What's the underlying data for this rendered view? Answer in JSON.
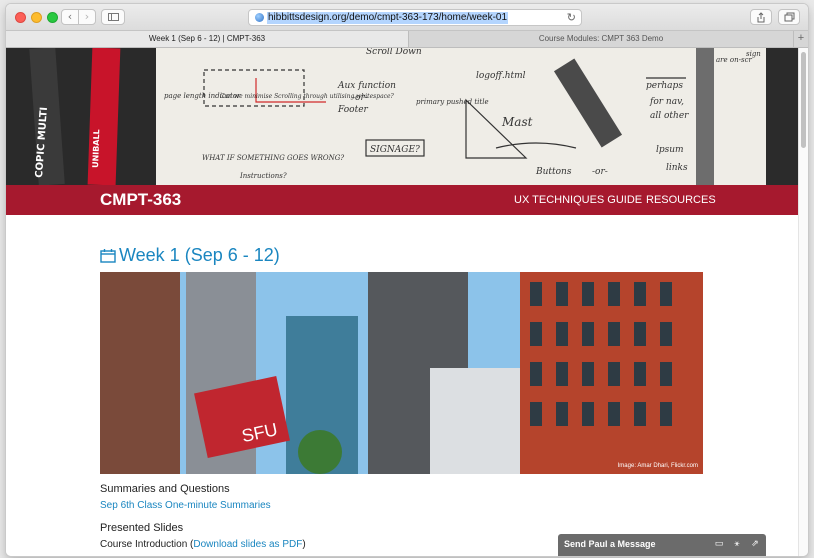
{
  "browser": {
    "url": "hibbittsdesign.org/demo/cmpt-363-173/home/week-01",
    "tabs": [
      {
        "label": "Week 1 (Sep 6 - 12) | CMPT-363",
        "active": true
      },
      {
        "label": "Course Modules: CMPT 363 Demo",
        "active": false
      }
    ],
    "nav_back_icon": "chevron-left-icon",
    "nav_forward_icon": "chevron-right-icon",
    "sidebar_icon": "sidebar-icon",
    "reload_icon": "reload-icon",
    "share_icon": "share-icon",
    "tabs_icon": "tabs-overview-icon",
    "new_tab_icon": "plus-icon"
  },
  "site": {
    "title": "CMPT-363",
    "nav": [
      "UX TECHNIQUES GUIDE",
      "RESOURCES"
    ],
    "brand_color": "#a6192e",
    "link_color": "#1a86c0"
  },
  "page": {
    "heading": "Week 1 (Sep 6 - 12)",
    "heading_icon": "calendar-icon",
    "photo_credit": "Image: Amar Dhari, Flickr.com",
    "summaries_heading": "Summaries and Questions",
    "summaries_link": "Sep 6th Class One-minute Summaries",
    "slides_heading": "Presented Slides",
    "slides_item_prefix": "Course Introduction (",
    "slides_item_link": "Download slides as PDF",
    "slides_item_suffix": ")"
  },
  "hero_sketch": {
    "texts": [
      "Scroll Down",
      "logoff.html",
      "page length indicator",
      "Can we minimise Scrolling through utilising whitespace?",
      "Aux function",
      "-or-",
      "Footer",
      "primary pushed title",
      "SIGNAGE?",
      "Mast",
      "WHAT IF SOMETHING GOES WRONG?",
      "Instructions?",
      "Buttons",
      "-or-",
      "perhaps",
      "for nav,",
      "all other",
      "lpsum",
      "links",
      "are on-scr",
      "sign",
      "UNIBALL",
      "COPIC MULTI"
    ]
  },
  "chat": {
    "label": "Send Paul a Message",
    "icons": [
      "window-icon",
      "bell-icon",
      "expand-icon"
    ]
  }
}
